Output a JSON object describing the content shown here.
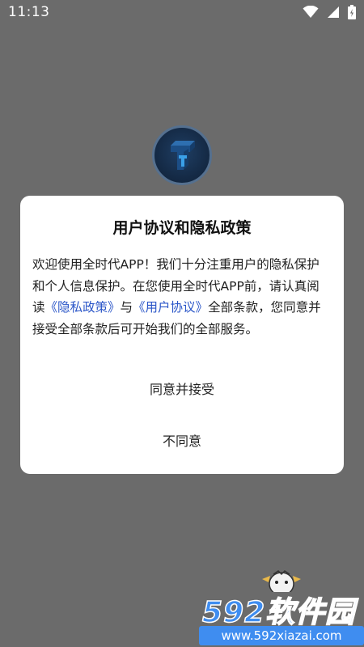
{
  "status_bar": {
    "time": "11:13",
    "icons": [
      "wifi-icon",
      "cell-signal-icon",
      "battery-icon"
    ]
  },
  "logo": {
    "icon": "app-logo-icon",
    "colors": {
      "ring": "#55708f",
      "face": "#1f3e63",
      "glyph": "#3aa0e8"
    }
  },
  "dialog": {
    "title": "用户协议和隐私政策",
    "body": {
      "segment1": "欢迎使用全时代APP！我们十分注重用户的隐私保护和个人信息保护。在您使用全时代APP前，请认真阅读",
      "privacy_link": "《隐私政策》",
      "segment2": "与",
      "agreement_link": "《用户协议》",
      "segment3": "全部条款，您同意并接受全部条款后可开始我们的全部服务。"
    },
    "agree_label": "同意并接受",
    "disagree_label": "不同意",
    "link_color": "#2b56c8"
  },
  "watermark": {
    "brand": "592软件园",
    "url": "www.592xiazai.com",
    "color": "#3f8df0"
  },
  "mascot": {
    "icon": "mascot-icon"
  },
  "colors": {
    "overlay": "#6b6b6b",
    "dialog_bg": "#ffffff",
    "text": "#222222"
  }
}
